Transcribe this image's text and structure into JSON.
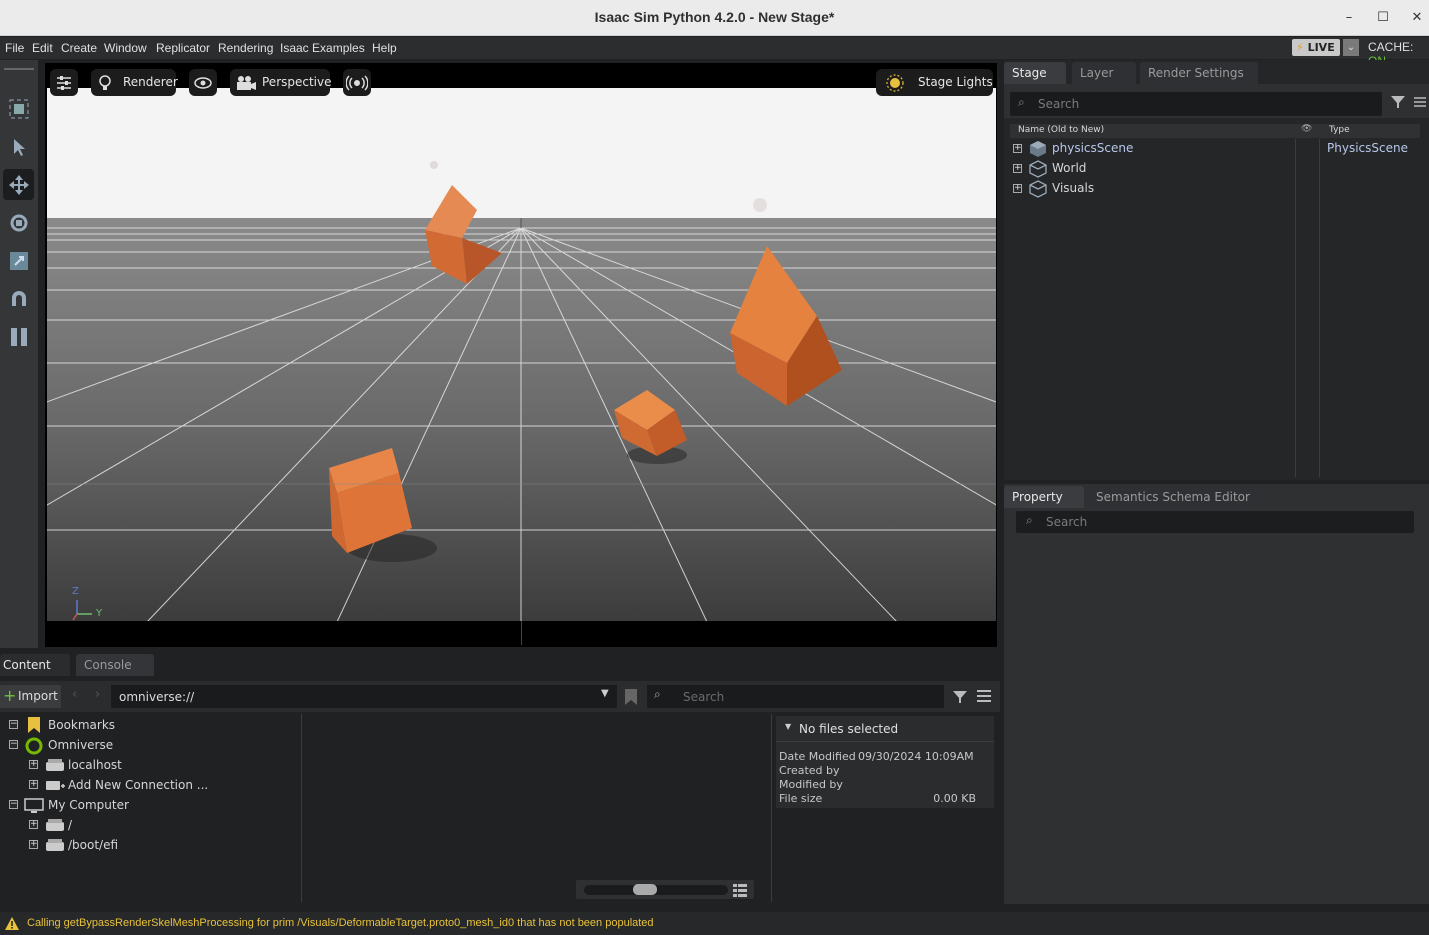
{
  "window": {
    "title": "Isaac Sim Python 4.2.0 - New Stage*"
  },
  "menu": [
    "File",
    "Edit",
    "Create",
    "Window",
    "Replicator",
    "Rendering",
    "Isaac Examples",
    "Help"
  ],
  "status_right": {
    "live_label": "LIVE",
    "cache_label": "CACHE:",
    "cache_state": "ON"
  },
  "viewport": {
    "renderer_label": "Renderer",
    "camera_label": "Perspective",
    "lights_label": "Stage Lights",
    "axis_z": "Z",
    "axis_y": "Y"
  },
  "stage": {
    "tabs": [
      "Stage",
      "Layer",
      "Render Settings"
    ],
    "search_placeholder": "Search",
    "col_name": "Name (Old to New)",
    "col_type": "Type",
    "items": [
      {
        "name": "physicsScene",
        "type": "PhysicsScene"
      },
      {
        "name": "World",
        "type": ""
      },
      {
        "name": "Visuals",
        "type": ""
      }
    ]
  },
  "property": {
    "tabs": [
      "Property",
      "Semantics Schema Editor"
    ],
    "search_placeholder": "Search"
  },
  "content": {
    "tabs": [
      "Content",
      "Console"
    ],
    "import_label": "Import",
    "path": "omniverse://",
    "search_placeholder": "Search",
    "tree": [
      {
        "label": "Bookmarks",
        "level": 0,
        "expander": "-"
      },
      {
        "label": "Omniverse",
        "level": 0,
        "expander": "-"
      },
      {
        "label": "localhost",
        "level": 1,
        "expander": "+"
      },
      {
        "label": "Add New Connection ...",
        "level": 1,
        "expander": "+"
      },
      {
        "label": "My Computer",
        "level": 0,
        "expander": "-"
      },
      {
        "label": "/",
        "level": 1,
        "expander": "+"
      },
      {
        "label": "/boot/efi",
        "level": 1,
        "expander": "+"
      }
    ],
    "info": {
      "header": "No files selected",
      "date_modified_label": "Date Modified",
      "date_modified_value": "09/30/2024 10:09AM",
      "created_by_label": "Created by",
      "modified_by_label": "Modified by",
      "file_size_label": "File size",
      "file_size_value": "0.00 KB"
    }
  },
  "statusbar": {
    "message": "Calling getBypassRenderSkelMeshProcessing for prim /Visuals/DeformableTarget.proto0_mesh_id0 that has not been populated"
  },
  "colors": {
    "accent_orange": "#e0733a",
    "warning": "#e8c23a",
    "live_green": "#70c040"
  }
}
